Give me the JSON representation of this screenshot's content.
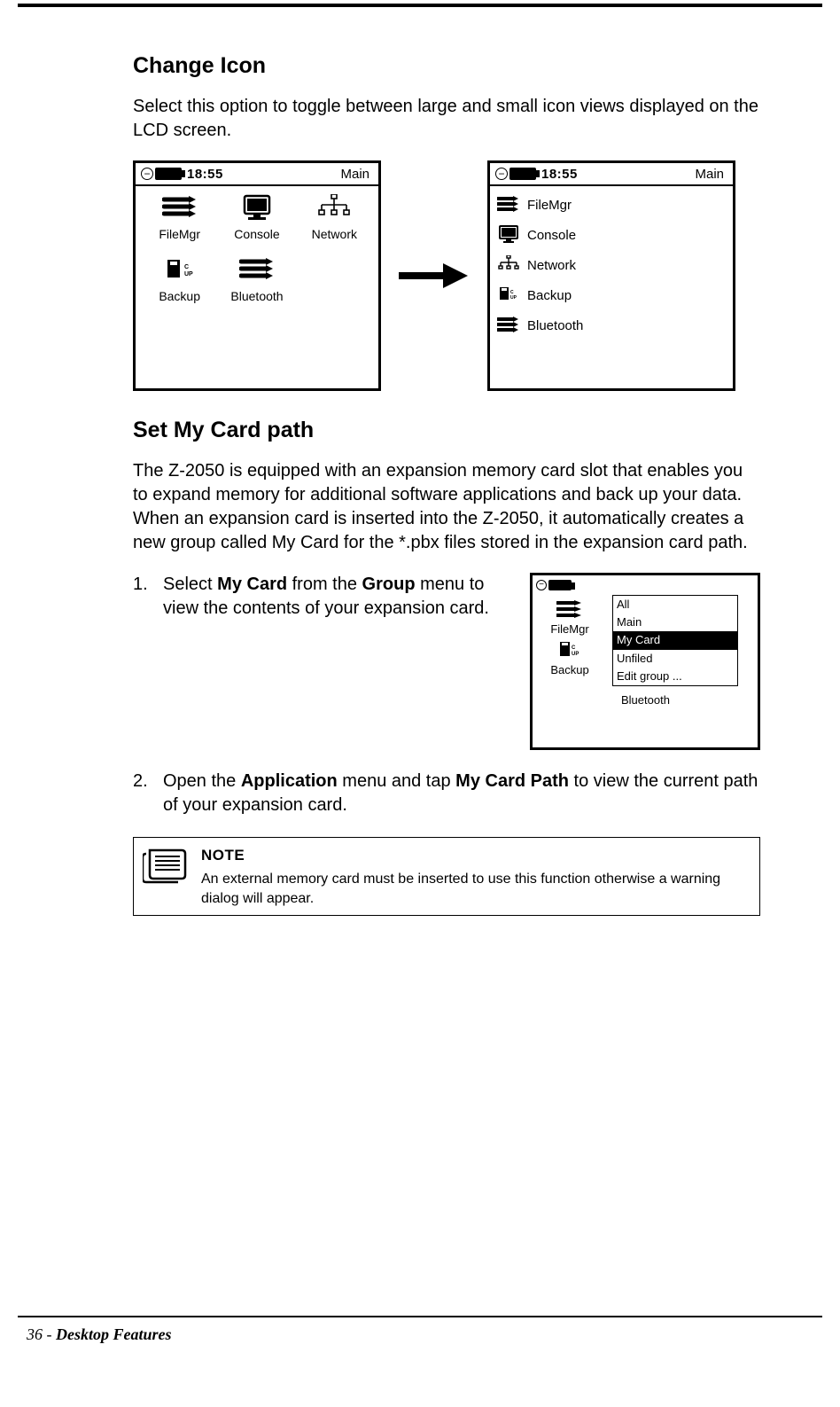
{
  "section1": {
    "heading": "Change Icon",
    "para": "Select this option to toggle between large and small icon views displayed on the LCD screen."
  },
  "fig1": {
    "time": "18:55",
    "title": "Main",
    "large_icons": [
      {
        "name": "FileMgr"
      },
      {
        "name": "Console"
      },
      {
        "name": "Network"
      },
      {
        "name": "Backup"
      },
      {
        "name": "Bluetooth"
      }
    ]
  },
  "fig2": {
    "time": "18:55",
    "title": "Main",
    "list_icons": [
      {
        "name": "FileMgr"
      },
      {
        "name": "Console"
      },
      {
        "name": "Network"
      },
      {
        "name": "Backup"
      },
      {
        "name": "Bluetooth"
      }
    ]
  },
  "section2": {
    "heading": "Set My Card path",
    "para1": "The Z-2050 is equipped with an expansion memory card slot that enables you to expand memory for additional software applications and back up your data.",
    "para2": "When an expansion card is inserted into the Z-2050, it automatically creates a new group called My Card for the *.pbx files stored in the expansion card path."
  },
  "steps": {
    "s1_a": "Select ",
    "s1_b1": "My Card",
    "s1_c": " from the ",
    "s1_b2": "Group",
    "s1_d": " menu to view the contents of your expansion card.",
    "s2_a": "Open the ",
    "s2_b1": "Application",
    "s2_c": " menu and tap ",
    "s2_b2": "My Card Path",
    "s2_d": " to view the current path of your expansion card."
  },
  "fig3": {
    "left_items": [
      {
        "name": "FileMgr"
      },
      {
        "name": "Backup"
      }
    ],
    "bluetooth_label": "Bluetooth",
    "dropdown": {
      "items": [
        {
          "label": "All",
          "selected": false
        },
        {
          "label": "Main",
          "selected": false
        },
        {
          "label": "My  Card",
          "selected": true
        },
        {
          "label": "Unfiled",
          "selected": false
        },
        {
          "label": "Edit group  ...",
          "selected": false
        }
      ]
    }
  },
  "note": {
    "heading": "NOTE",
    "body": "An external memory card must be inserted to use this function otherwise a warning dialog will appear."
  },
  "footer": {
    "page_num": "36",
    "sep": "  -  ",
    "title": "Desktop Features"
  }
}
